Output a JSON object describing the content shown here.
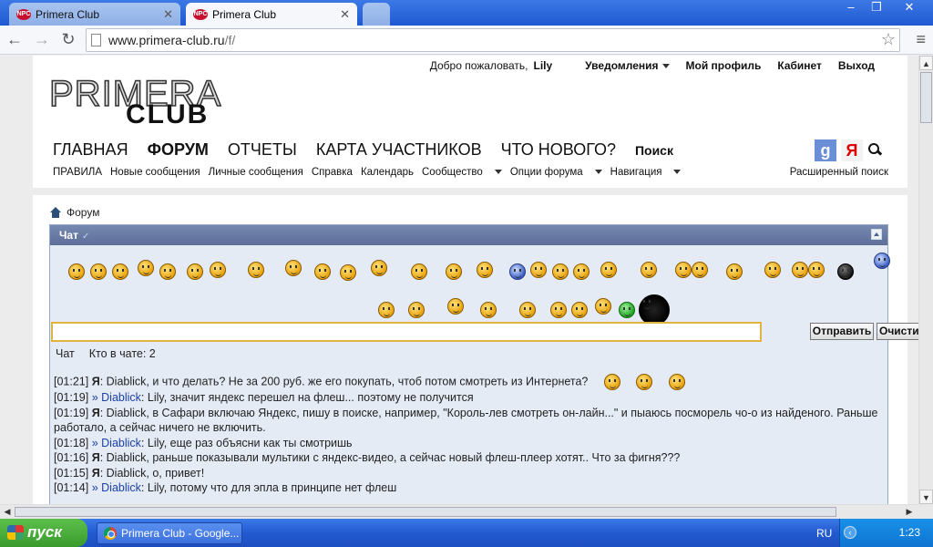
{
  "browser": {
    "tabs": [
      {
        "title": "Primera Club",
        "favicon": "npc-favicon",
        "active": false
      },
      {
        "title": "Primera Club",
        "favicon": "npc-favicon",
        "active": true
      }
    ],
    "url_host": "www.primera-club.ru",
    "url_path": "/f/"
  },
  "header": {
    "welcome": "Добро пожаловать,",
    "username": "Lily",
    "notifications": "Уведомления",
    "profile": "Мой профиль",
    "cabinet": "Кабинет",
    "logout": "Выход",
    "logo_line1": "PRIMERA",
    "logo_line2": "CLUB"
  },
  "mainnav": {
    "home": "ГЛАВНАЯ",
    "forum": "ФОРУМ",
    "reports": "ОТЧЕТЫ",
    "map": "КАРТА УЧАСТНИКОВ",
    "whatsnew": "ЧТО НОВОГО?",
    "search": "Поиск"
  },
  "subnav": {
    "rules": "ПРАВИЛА",
    "newposts": "Новые сообщения",
    "pm": "Личные сообщения",
    "help": "Справка",
    "calendar": "Календарь",
    "community": "Сообщество",
    "forum_options": "Опции форума",
    "navigation": "Навигация",
    "advanced_search": "Расширенный поиск"
  },
  "breadcrumb": {
    "label": "Форум"
  },
  "chat": {
    "title": "Чат",
    "send_button": "Отправить",
    "clear_button": "Очистить",
    "tab_chat": "Чат",
    "tab_who": "Кто в чате: 2",
    "input_value": "",
    "messages": [
      {
        "time": "[01:21]",
        "prefix": "",
        "author": "Я",
        "text": ": Diablick, и что делать? Не за 200 руб. же его покупать, чтоб потом смотреть из Интернета?"
      },
      {
        "time": "[01:19]",
        "prefix": "»",
        "author": "Diablick",
        "text": ": Lily, значит яндекс перешел на флеш... поэтому не получится"
      },
      {
        "time": "[01:19]",
        "prefix": "",
        "author": "Я",
        "text": ": Diablick, в Сафари включаю Яндекс, пишу в поиске, например, \"Король-лев смотреть он-лайн...\" и пыаюсь посморель чо-о из найденого. Раньше работало, а сейчас ничего не включить."
      },
      {
        "time": "[01:18]",
        "prefix": "»",
        "author": "Diablick",
        "text": ": Lily, еще раз объясни как ты смотришь"
      },
      {
        "time": "[01:16]",
        "prefix": "",
        "author": "Я",
        "text": ": Diablick, раньше показывали мультики с яндекс-видео, а сейчас новый флеш-плеер хотят.. Что за фигня???"
      },
      {
        "time": "[01:15]",
        "prefix": "",
        "author": "Я",
        "text": ": Diablick, о, привет!"
      },
      {
        "time": "[01:14]",
        "prefix": "»",
        "author": "Diablick",
        "text": ": Lily, потому что для эпла в принципе нет флеш"
      }
    ]
  },
  "taskbar": {
    "start": "пуск",
    "task": "Primera Club - Google...",
    "lang": "RU",
    "clock": "1:23"
  },
  "colors": {
    "chat_header": "#5d6f99",
    "chat_bg": "#e5ebf5",
    "user_link": "#1a3fa8",
    "input_border": "#e0b343"
  }
}
